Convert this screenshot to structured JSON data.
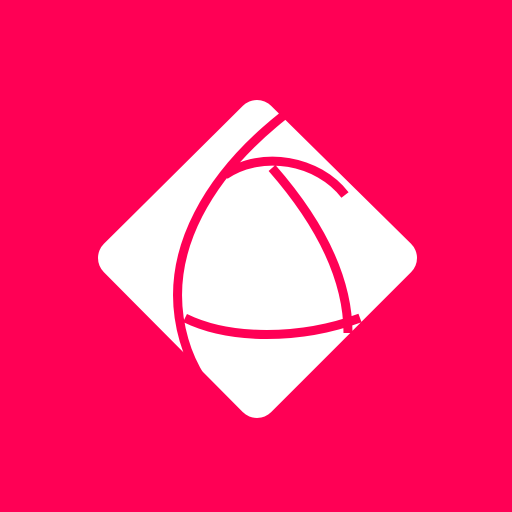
{
  "icon": {
    "name": "app-logo-icon",
    "background_color": "#FF0055",
    "shape_color": "#FFFFFF",
    "line_color": "#FF0055"
  }
}
